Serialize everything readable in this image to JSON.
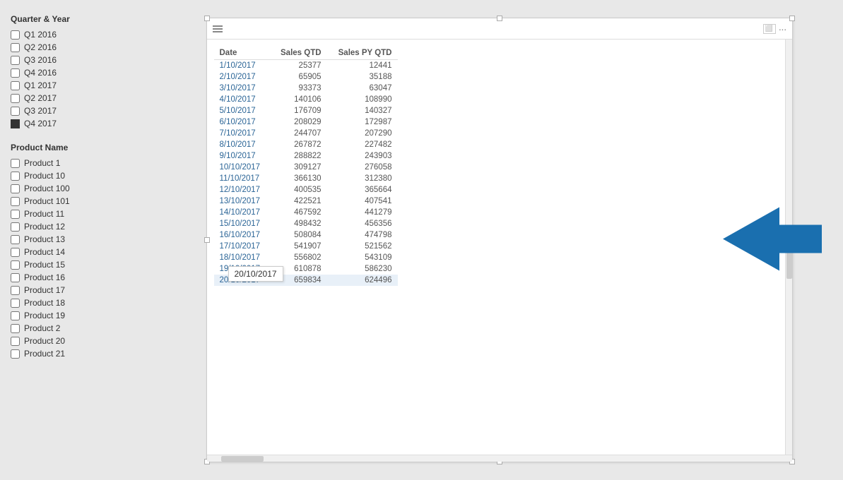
{
  "left_panel": {
    "quarter_title": "Quarter & Year",
    "quarters": [
      {
        "label": "Q1 2016",
        "checked": false
      },
      {
        "label": "Q2 2016",
        "checked": false
      },
      {
        "label": "Q3 2016",
        "checked": false
      },
      {
        "label": "Q4 2016",
        "checked": false
      },
      {
        "label": "Q1 2017",
        "checked": false
      },
      {
        "label": "Q2 2017",
        "checked": false
      },
      {
        "label": "Q3 2017",
        "checked": false
      },
      {
        "label": "Q4 2017",
        "checked": true
      }
    ],
    "product_title": "Product Name",
    "products": [
      {
        "label": "Product 1"
      },
      {
        "label": "Product 10"
      },
      {
        "label": "Product 100"
      },
      {
        "label": "Product 101"
      },
      {
        "label": "Product 11"
      },
      {
        "label": "Product 12"
      },
      {
        "label": "Product 13"
      },
      {
        "label": "Product 14"
      },
      {
        "label": "Product 15"
      },
      {
        "label": "Product 16"
      },
      {
        "label": "Product 17"
      },
      {
        "label": "Product 18"
      },
      {
        "label": "Product 19"
      },
      {
        "label": "Product 2"
      },
      {
        "label": "Product 20"
      },
      {
        "label": "Product 21"
      }
    ]
  },
  "table": {
    "headers": [
      "Date",
      "Sales QTD",
      "Sales PY QTD"
    ],
    "rows": [
      {
        "date": "1/10/2017",
        "sales_qtd": "25377",
        "sales_py_qtd": "12441"
      },
      {
        "date": "2/10/2017",
        "sales_qtd": "65905",
        "sales_py_qtd": "35188"
      },
      {
        "date": "3/10/2017",
        "sales_qtd": "93373",
        "sales_py_qtd": "63047"
      },
      {
        "date": "4/10/2017",
        "sales_qtd": "140106",
        "sales_py_qtd": "108990"
      },
      {
        "date": "5/10/2017",
        "sales_qtd": "176709",
        "sales_py_qtd": "140327"
      },
      {
        "date": "6/10/2017",
        "sales_qtd": "208029",
        "sales_py_qtd": "172987"
      },
      {
        "date": "7/10/2017",
        "sales_qtd": "244707",
        "sales_py_qtd": "207290"
      },
      {
        "date": "8/10/2017",
        "sales_qtd": "267872",
        "sales_py_qtd": "227482"
      },
      {
        "date": "9/10/2017",
        "sales_qtd": "288822",
        "sales_py_qtd": "243903"
      },
      {
        "date": "10/10/2017",
        "sales_qtd": "309127",
        "sales_py_qtd": "276058"
      },
      {
        "date": "11/10/2017",
        "sales_qtd": "366130",
        "sales_py_qtd": "312380"
      },
      {
        "date": "12/10/2017",
        "sales_qtd": "400535",
        "sales_py_qtd": "365664"
      },
      {
        "date": "13/10/2017",
        "sales_qtd": "422521",
        "sales_py_qtd": "407541"
      },
      {
        "date": "14/10/2017",
        "sales_qtd": "467592",
        "sales_py_qtd": "441279"
      },
      {
        "date": "15/10/2017",
        "sales_qtd": "498432",
        "sales_py_qtd": "456356"
      },
      {
        "date": "16/10/2017",
        "sales_qtd": "508084",
        "sales_py_qtd": "474798"
      },
      {
        "date": "17/10/2017",
        "sales_qtd": "541907",
        "sales_py_qtd": "521562"
      },
      {
        "date": "18/10/2017",
        "sales_qtd": "556802",
        "sales_py_qtd": "543109"
      },
      {
        "date": "19/10/2017",
        "sales_qtd": "610878",
        "sales_py_qtd": "586230"
      },
      {
        "date": "20/10/2017",
        "sales_qtd": "659834",
        "sales_py_qtd": "624496",
        "highlighted": true
      }
    ]
  },
  "tooltip": {
    "text": "20/10/2017"
  },
  "toolbar": {
    "maximize_label": "⬜",
    "menu_label": "···"
  }
}
